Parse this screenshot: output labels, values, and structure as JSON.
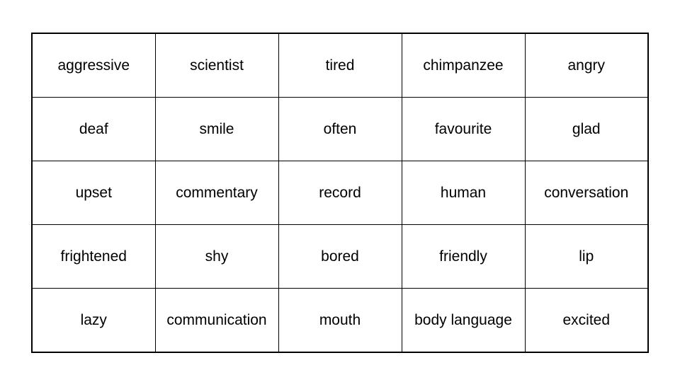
{
  "table": {
    "rows": [
      [
        "aggressive",
        "scientist",
        "tired",
        "chimpanzee",
        "angry"
      ],
      [
        "deaf",
        "smile",
        "often",
        "favourite",
        "glad"
      ],
      [
        "upset",
        "commentary",
        "record",
        "human",
        "conversation"
      ],
      [
        "frightened",
        "shy",
        "bored",
        "friendly",
        "lip"
      ],
      [
        "lazy",
        "communication",
        "mouth",
        "body language",
        "excited"
      ]
    ]
  }
}
